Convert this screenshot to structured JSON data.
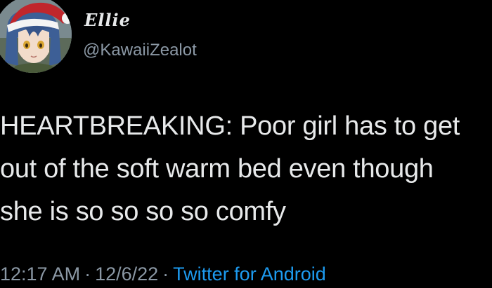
{
  "author": {
    "display_name": "Ellie",
    "handle": "@KawaiiZealot",
    "avatar_icon": "anime-girl-santa-hat-avatar"
  },
  "tweet": {
    "lines": [
      "HEARTBREAKING: Poor girl has to get",
      "out of the soft warm bed even though",
      "she is so so so so comfy"
    ]
  },
  "meta": {
    "time": "12:17 AM",
    "date": "12/6/22",
    "separator": "·",
    "source": "Twitter for Android"
  },
  "colors": {
    "background": "#000000",
    "text_primary": "#e7e9ea",
    "text_secondary": "#8b98a5",
    "link": "#1d9bf0"
  }
}
